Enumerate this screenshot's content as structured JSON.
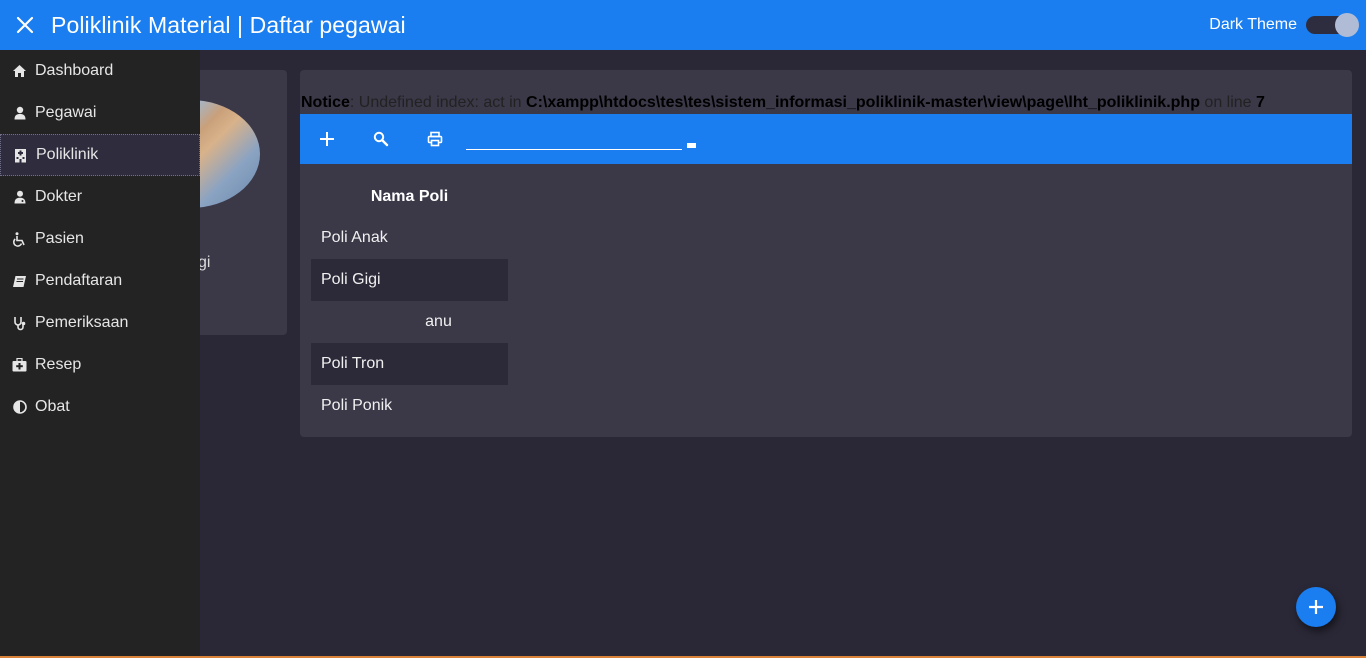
{
  "header": {
    "title": "Poliklinik Material | Daftar pegawai",
    "theme_label": "Dark Theme",
    "dark_theme_on": true
  },
  "sidebar": {
    "items": [
      {
        "label": "Dashboard",
        "icon": "home-icon"
      },
      {
        "label": "Pegawai",
        "icon": "user-icon"
      },
      {
        "label": "Poliklinik",
        "icon": "hospital-icon",
        "active": true
      },
      {
        "label": "Dokter",
        "icon": "doctor-icon"
      },
      {
        "label": "Pasien",
        "icon": "wheelchair-icon"
      },
      {
        "label": "Pendaftaran",
        "icon": "book-icon"
      },
      {
        "label": "Pemeriksaan",
        "icon": "stethoscope-icon"
      },
      {
        "label": "Resep",
        "icon": "medkit-icon"
      },
      {
        "label": "Obat",
        "icon": "half-circle-icon"
      }
    ]
  },
  "profile_card": {
    "partial_text": "gi"
  },
  "notice": {
    "label": "Notice",
    "message": ": Undefined index: act in ",
    "path": "C:\\xampp\\htdocs\\tes\\tes\\sistem_informasi_poliklinik-master\\view\\page\\lht_poliklinik.php",
    "line_text": " on line ",
    "line_no": "7"
  },
  "toolbar": {
    "search_value": ""
  },
  "table": {
    "header": "Nama Poli",
    "rows": [
      "Poli Anak",
      "Poli Gigi",
      "anu",
      "Poli Tron",
      "Poli Ponik"
    ]
  },
  "colors": {
    "primary": "#1a7ef0",
    "background": "#2a2836",
    "card": "#3b3848",
    "sidebar": "#232323"
  }
}
